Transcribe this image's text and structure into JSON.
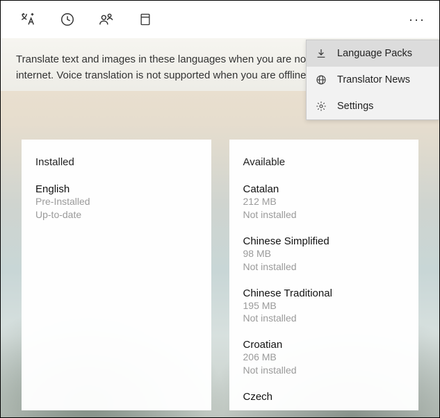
{
  "toolbar": {
    "icons": [
      "translate-icon",
      "history-icon",
      "conversation-icon",
      "phrasebook-icon"
    ],
    "more_glyph": "···"
  },
  "menu": {
    "items": [
      {
        "icon": "download-icon",
        "label": "Language Packs",
        "selected": true
      },
      {
        "icon": "globe-icon",
        "label": "Translator News",
        "selected": false
      },
      {
        "icon": "gear-icon",
        "label": "Settings",
        "selected": false
      }
    ]
  },
  "info_text": "Translate text and images in these languages when you are not connected to the internet. Voice translation is not supported when you are offline.",
  "installed": {
    "heading": "Installed",
    "items": [
      {
        "name": "English",
        "meta": "Pre-Installed",
        "meta2": "Up-to-date"
      }
    ]
  },
  "available": {
    "heading": "Available",
    "items": [
      {
        "name": "Catalan",
        "meta": "212 MB",
        "meta2": "Not installed"
      },
      {
        "name": "Chinese Simplified",
        "meta": "98 MB",
        "meta2": "Not installed"
      },
      {
        "name": "Chinese Traditional",
        "meta": "195 MB",
        "meta2": "Not installed"
      },
      {
        "name": "Croatian",
        "meta": "206 MB",
        "meta2": "Not installed"
      },
      {
        "name": "Czech",
        "meta": "",
        "meta2": ""
      }
    ]
  }
}
